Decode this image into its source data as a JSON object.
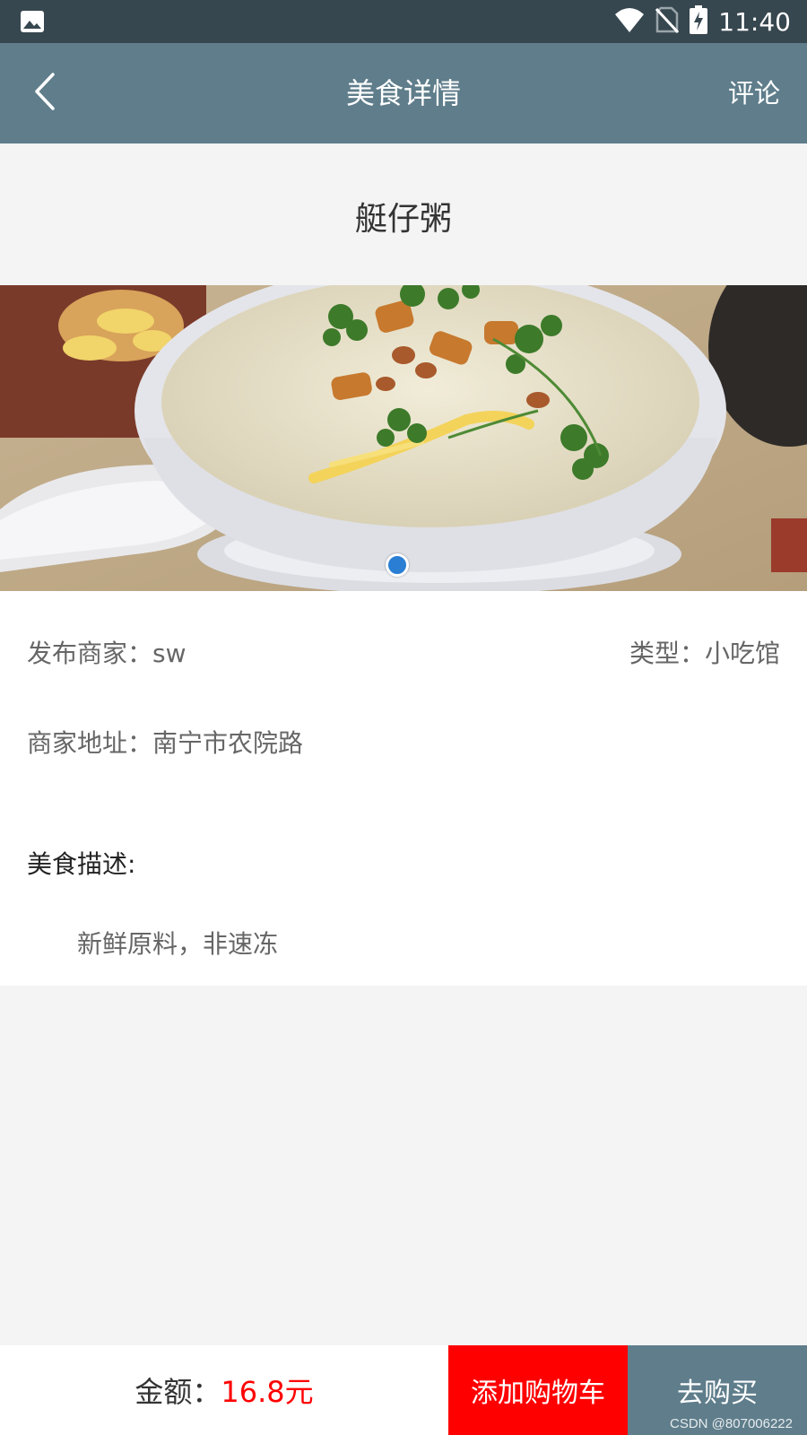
{
  "status_bar": {
    "time": "11:40",
    "icons": [
      "image-notification-icon",
      "wifi-icon",
      "no-sim-icon",
      "battery-charging-icon"
    ]
  },
  "app_bar": {
    "back_icon": "back-arrow-icon",
    "title": "美食详情",
    "comment_label": "评论"
  },
  "food": {
    "name": "艇仔粥",
    "image_alt": "bowl-of-congee-image",
    "merchant_label": "发布商家：",
    "merchant_value": "sw",
    "type_label": "类型：",
    "type_value": "小吃馆",
    "address_label": "商家地址：",
    "address_value": "南宁市农院路",
    "description_label": "美食描述:",
    "description_value": "新鲜原料，非速冻"
  },
  "bottom_bar": {
    "amount_label": "金额：",
    "amount_value": "16.8元",
    "add_cart_label": "添加购物车",
    "buy_label": "去购买",
    "watermark": "CSDN @807006222"
  },
  "colors": {
    "status_bar": "#37474f",
    "app_bar": "#5f7d8b",
    "add_cart": "#ff0000",
    "buy": "#5f7d8b",
    "price": "#ff0000"
  }
}
